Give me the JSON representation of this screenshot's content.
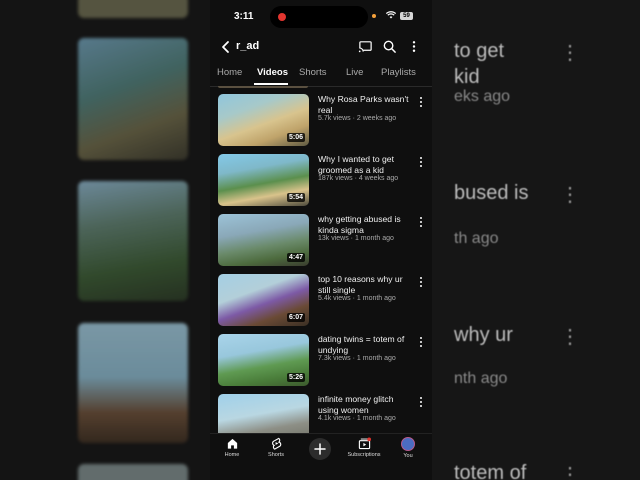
{
  "status_bar": {
    "time": "3:11",
    "battery": "59"
  },
  "header": {
    "channel_name": "r_ad"
  },
  "tabs": [
    {
      "label": "Home"
    },
    {
      "label": "Videos"
    },
    {
      "label": "Shorts"
    },
    {
      "label": "Live"
    },
    {
      "label": "Playlists"
    }
  ],
  "active_tab": "Videos",
  "videos": [
    {
      "title": "Why Rosa Parks wasn't real",
      "meta": "5.7k views · 2 weeks ago",
      "duration": "5:06"
    },
    {
      "title": "Why I wanted to get groomed as a kid",
      "meta": "187k views · 4 weeks ago",
      "duration": "5:54"
    },
    {
      "title": "why getting abused is kinda sigma",
      "meta": "13k views · 1 month ago",
      "duration": "4:47"
    },
    {
      "title": "top 10 reasons why ur still single",
      "meta": "5.4k views · 1 month ago",
      "duration": "6:07"
    },
    {
      "title": "dating twins = totem of undying",
      "meta": "7.3k views · 1 month ago",
      "duration": "5:26"
    },
    {
      "title": "infinite money glitch using women",
      "meta": "4.1k views · 1 month ago",
      "duration": ""
    }
  ],
  "bottom_nav": [
    {
      "label": "Home",
      "icon": "home-icon"
    },
    {
      "label": "Shorts",
      "icon": "shorts-icon"
    },
    {
      "label": "",
      "icon": "create-plus-icon"
    },
    {
      "label": "Subscriptions",
      "icon": "subscriptions-icon"
    },
    {
      "label": "You",
      "icon": "avatar"
    }
  ],
  "background_fragments": {
    "line1": "to get",
    "line2": "kid",
    "line3": "eks ago",
    "line4": "bused is",
    "line5": "th ago",
    "line6": "why ur",
    "line7": "nth ago",
    "line8": "totem of"
  },
  "colors": {
    "background": "#0f0f0f",
    "accent_red": "#e2352f",
    "text_secondary": "#aaaaaa"
  }
}
